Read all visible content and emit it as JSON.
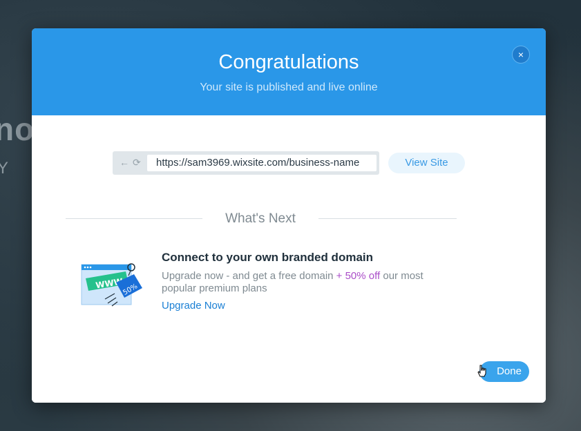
{
  "background": {
    "text_1": "nox",
    "text_2": "Y"
  },
  "modal": {
    "title": "Congratulations",
    "subtitle": "Your site is published and live online",
    "close_icon": "×",
    "url": {
      "back_icon": "←",
      "refresh_icon": "⟳",
      "value": "https://sam3969.wixsite.com/business-name"
    },
    "view_site_label": "View Site",
    "whats_next": "What's Next",
    "promo": {
      "illustration_www": "WWW",
      "illustration_tag": "50%",
      "title": "Connect to your own branded domain",
      "text_before": "Upgrade now - and get a free domain ",
      "text_highlight": "+ 50% off",
      "text_after": " our most popular premium plans",
      "link_label": "Upgrade Now"
    },
    "done_label": "Done"
  },
  "colors": {
    "header": "#2a97e8",
    "accent": "#3aa4ec",
    "link": "#1a7fd4",
    "highlight": "#aa4dc8"
  }
}
